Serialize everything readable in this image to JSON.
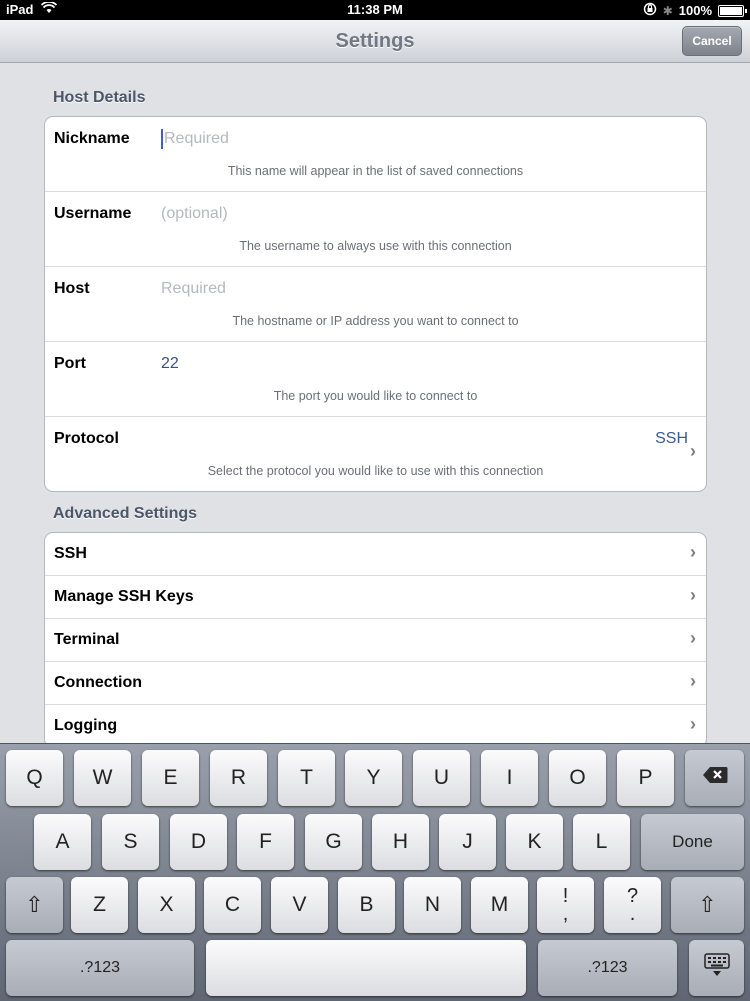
{
  "status_bar": {
    "device": "iPad",
    "time": "11:38 PM",
    "battery": "100%"
  },
  "navbar": {
    "title": "Settings",
    "cancel_label": "Cancel"
  },
  "host_details": {
    "header": "Host Details",
    "fields": [
      {
        "label": "Nickname",
        "placeholder": "Required",
        "value": "",
        "hint": "This name will appear in the list of saved connections"
      },
      {
        "label": "Username",
        "placeholder": "(optional)",
        "value": "",
        "hint": "The username to always use with this connection"
      },
      {
        "label": "Host",
        "placeholder": "Required",
        "value": "",
        "hint": "The hostname or IP address you want to connect to"
      },
      {
        "label": "Port",
        "placeholder": "",
        "value": "22",
        "hint": "The port you would like to connect to"
      }
    ],
    "protocol": {
      "label": "Protocol",
      "value": "SSH",
      "hint": "Select the protocol you would like to use with this connection"
    }
  },
  "advanced_settings": {
    "header": "Advanced Settings",
    "items": [
      "SSH",
      "Manage SSH Keys",
      "Terminal",
      "Connection",
      "Logging"
    ]
  },
  "keyboard": {
    "row1": [
      "Q",
      "W",
      "E",
      "R",
      "T",
      "Y",
      "U",
      "I",
      "O",
      "P"
    ],
    "row2": [
      "A",
      "S",
      "D",
      "F",
      "G",
      "H",
      "J",
      "K",
      "L"
    ],
    "row3": [
      "Z",
      "X",
      "C",
      "V",
      "B",
      "N",
      "M"
    ],
    "punct1_top": "!",
    "punct1_bottom": ",",
    "punct2_top": "?",
    "punct2_bottom": ".",
    "done_label": "Done",
    "numbers_label": ".?123"
  }
}
